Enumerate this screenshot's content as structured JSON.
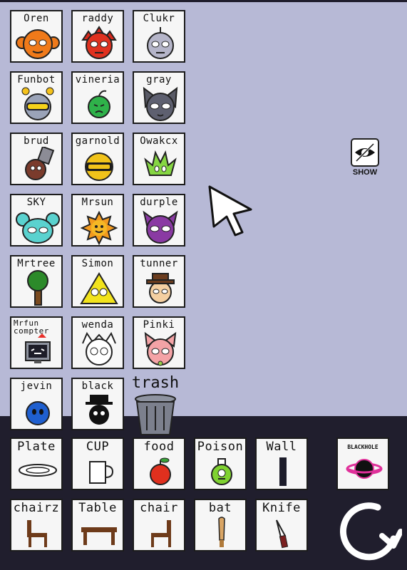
{
  "characters": [
    {
      "label": "Oren"
    },
    {
      "label": "raddy"
    },
    {
      "label": "Clukr"
    },
    {
      "label": "Funbot"
    },
    {
      "label": "vineria"
    },
    {
      "label": "gray"
    },
    {
      "label": "brud"
    },
    {
      "label": "garnold"
    },
    {
      "label": "Owakcx"
    },
    {
      "label": "SKY"
    },
    {
      "label": "Mrsun"
    },
    {
      "label": "durple"
    },
    {
      "label": "Mrtree"
    },
    {
      "label": "Simon"
    },
    {
      "label": "tunner"
    },
    {
      "label": "Mrfun compter"
    },
    {
      "label": "wenda"
    },
    {
      "label": "Pinki"
    },
    {
      "label": "jevin"
    },
    {
      "label": "black"
    }
  ],
  "trash": {
    "label": "trash",
    "icon": "trash-can-icon"
  },
  "show": {
    "label": "SHOW",
    "icon": "eye-hidden-icon"
  },
  "items": [
    {
      "label": "Plate",
      "icon": "plate-icon"
    },
    {
      "label": "CUP",
      "icon": "cup-icon"
    },
    {
      "label": "food",
      "icon": "apple-icon"
    },
    {
      "label": "Poison",
      "icon": "poison-bottle-icon"
    },
    {
      "label": "Wall",
      "icon": "wall-icon"
    },
    {
      "label": "BLACKHOLE",
      "icon": "black-hole-icon"
    },
    {
      "label": "chairz",
      "icon": "chair-icon"
    },
    {
      "label": "Table",
      "icon": "table-icon"
    },
    {
      "label": "chair",
      "icon": "chair-icon"
    },
    {
      "label": "bat",
      "icon": "bat-icon"
    },
    {
      "label": "Knife",
      "icon": "knife-icon"
    }
  ],
  "reset": {
    "icon": "reset-arrow-icon"
  },
  "cursor": {
    "icon": "pointer-cursor-icon"
  },
  "colors": {
    "stage": "#b7b9d6",
    "tray": "#201e2d",
    "tile": "#f6f6f6"
  }
}
